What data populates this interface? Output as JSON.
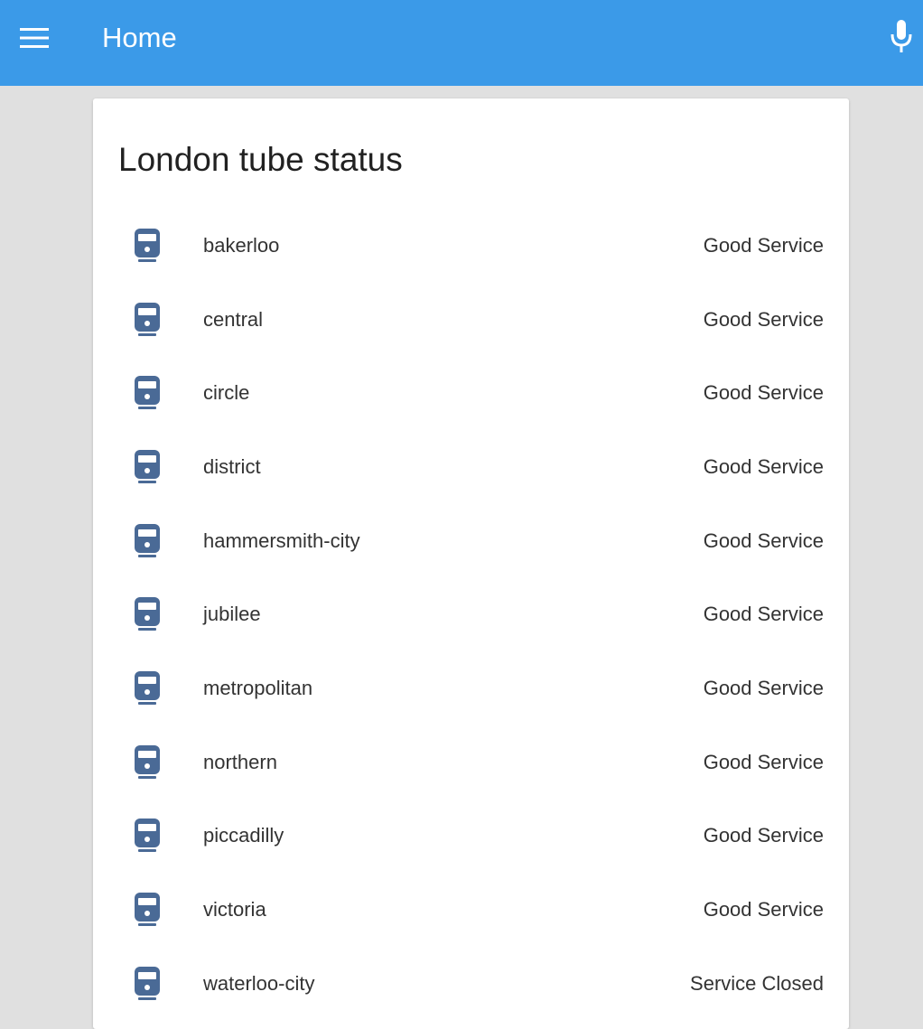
{
  "header": {
    "title": "Home",
    "menu_icon": "menu-icon",
    "mic_icon": "microphone-icon",
    "background_color": "#3b9ae8"
  },
  "card": {
    "title": "London tube status",
    "icon": "train-icon",
    "icon_color": "#4a6a96",
    "lines": [
      {
        "name": "bakerloo",
        "status": "Good Service"
      },
      {
        "name": "central",
        "status": "Good Service"
      },
      {
        "name": "circle",
        "status": "Good Service"
      },
      {
        "name": "district",
        "status": "Good Service"
      },
      {
        "name": "hammersmith-city",
        "status": "Good Service"
      },
      {
        "name": "jubilee",
        "status": "Good Service"
      },
      {
        "name": "metropolitan",
        "status": "Good Service"
      },
      {
        "name": "northern",
        "status": "Good Service"
      },
      {
        "name": "piccadilly",
        "status": "Good Service"
      },
      {
        "name": "victoria",
        "status": "Good Service"
      },
      {
        "name": "waterloo-city",
        "status": "Service Closed"
      }
    ]
  }
}
